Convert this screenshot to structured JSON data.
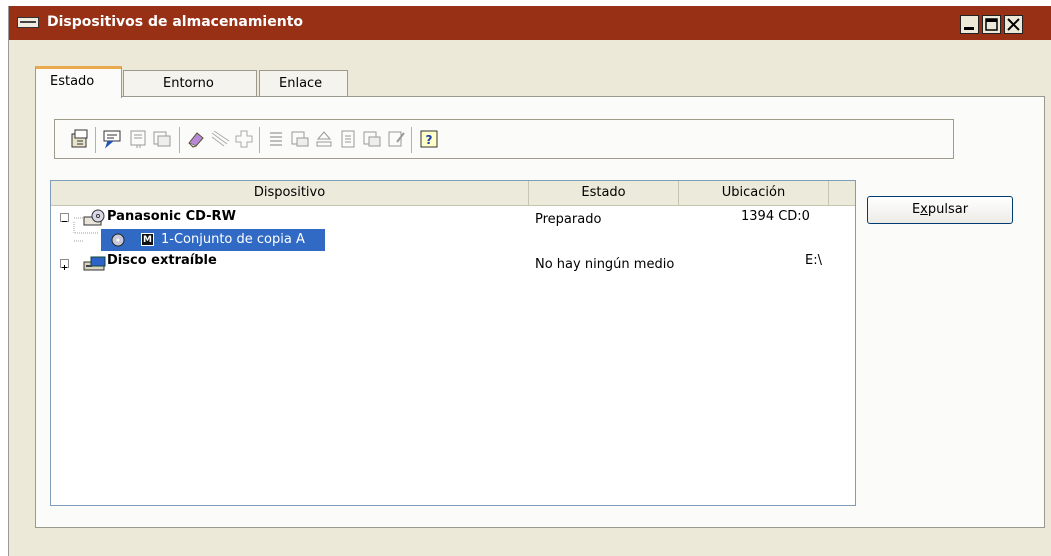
{
  "window": {
    "title": "Dispositivos de almacenamiento",
    "icon": "storage-device-icon",
    "controls": [
      "minimize-icon",
      "maximize-icon",
      "close-icon"
    ]
  },
  "tabs": [
    {
      "label": "Estado",
      "active": true
    },
    {
      "label": "Entorno",
      "active": false
    },
    {
      "label": "Enlace",
      "active": false
    }
  ],
  "toolbar": {
    "icons": [
      "properties-icon",
      "messages-icon",
      "device-settings-icon",
      "device-copy-icon",
      "erase-icon",
      "shield-icon",
      "add-icon",
      "list-icon",
      "print-device-icon",
      "eject-tray-icon",
      "document-icon",
      "device-export-icon",
      "notes-icon",
      "help-icon"
    ]
  },
  "devices": {
    "columns": [
      "Dispositivo",
      "Estado",
      "Ubicación"
    ],
    "rows": [
      {
        "name": "Panasonic CD-RW",
        "status": "Preparado",
        "location": "1394 CD:0",
        "expander": "−",
        "icon": "cd-drive-icon",
        "bold": true
      },
      {
        "name": "1-Conjunto de copia A",
        "status": "",
        "location": "",
        "icon": "disc-icon",
        "badge": "M",
        "selected": true
      },
      {
        "name": "Disco extraíble",
        "status": "No hay ningún medio",
        "location": "E:\\",
        "expander": "+",
        "icon": "removable-disk-icon",
        "bold": true
      }
    ]
  },
  "actions": {
    "eject_label": "Expulsar",
    "eject_mnemonic": "x"
  },
  "colors": {
    "titlebar": "#983016",
    "selection": "#316ac5",
    "active_tab_accent": "#e9a94d"
  }
}
